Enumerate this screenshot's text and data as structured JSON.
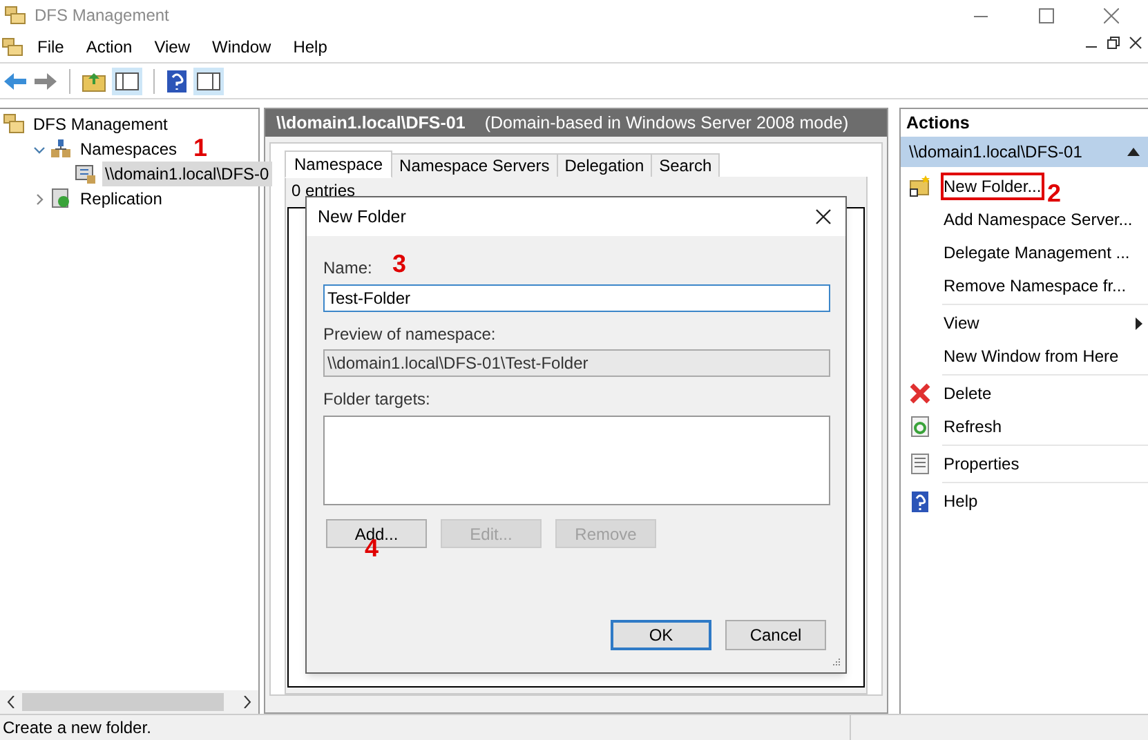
{
  "window": {
    "title": "DFS Management"
  },
  "menu": [
    "File",
    "Action",
    "View",
    "Window",
    "Help"
  ],
  "tree": [
    {
      "label": "DFS Management",
      "kind": "dfs",
      "selected": false,
      "children": [
        {
          "label": "Namespaces",
          "kind": "namespaces",
          "expanded": true,
          "selected": false,
          "children": [
            {
              "label": "\\\\domain1.local\\DFS-0",
              "kind": "namespace",
              "selected": true
            }
          ]
        },
        {
          "label": "Replication",
          "kind": "replication",
          "expanded": false,
          "selected": false
        }
      ]
    }
  ],
  "center": {
    "path": "\\\\domain1.local\\DFS-01",
    "mode": "(Domain-based in Windows Server 2008 mode)",
    "tabs": [
      {
        "label": "Namespace",
        "selected": true
      },
      {
        "label": "Namespace Servers",
        "selected": false
      },
      {
        "label": "Delegation",
        "selected": false
      },
      {
        "label": "Search",
        "selected": false
      }
    ],
    "entries": "0 entries"
  },
  "dialog": {
    "title": "New Folder",
    "name_label": "Name:",
    "name_value": "Test-Folder",
    "preview_label": "Preview of namespace:",
    "preview_value": "\\\\domain1.local\\DFS-01\\Test-Folder",
    "targets_label": "Folder targets:",
    "target_buttons": [
      {
        "label": "Add...",
        "disabled": false
      },
      {
        "label": "Edit...",
        "disabled": true
      },
      {
        "label": "Remove",
        "disabled": true
      }
    ],
    "ok": "OK",
    "cancel": "Cancel"
  },
  "actions": {
    "title": "Actions",
    "section": "\\\\domain1.local\\DFS-01",
    "items": [
      {
        "label": "New Folder...",
        "kind": "folder",
        "highlighted": true,
        "submenu": false,
        "separator_before": false
      },
      {
        "label": "Add Namespace Server...",
        "kind": "plain",
        "highlighted": false,
        "submenu": false,
        "separator_before": false
      },
      {
        "label": "Delegate Management ...",
        "kind": "plain",
        "highlighted": false,
        "submenu": false,
        "separator_before": false
      },
      {
        "label": "Remove Namespace fr...",
        "kind": "plain",
        "highlighted": false,
        "submenu": false,
        "separator_before": false
      },
      {
        "label": "View",
        "kind": "plain",
        "highlighted": false,
        "submenu": true,
        "separator_before": true
      },
      {
        "label": "New Window from Here",
        "kind": "plain",
        "highlighted": false,
        "submenu": false,
        "separator_before": false
      },
      {
        "label": "Delete",
        "kind": "delete",
        "highlighted": false,
        "submenu": false,
        "separator_before": true
      },
      {
        "label": "Refresh",
        "kind": "refresh",
        "highlighted": false,
        "submenu": false,
        "separator_before": false
      },
      {
        "label": "Properties",
        "kind": "properties",
        "highlighted": false,
        "submenu": false,
        "separator_before": true
      },
      {
        "label": "Help",
        "kind": "help",
        "highlighted": false,
        "submenu": false,
        "separator_before": true
      }
    ]
  },
  "annotations": [
    "1",
    "2",
    "3",
    "4"
  ],
  "status_bar": "Create a new folder."
}
